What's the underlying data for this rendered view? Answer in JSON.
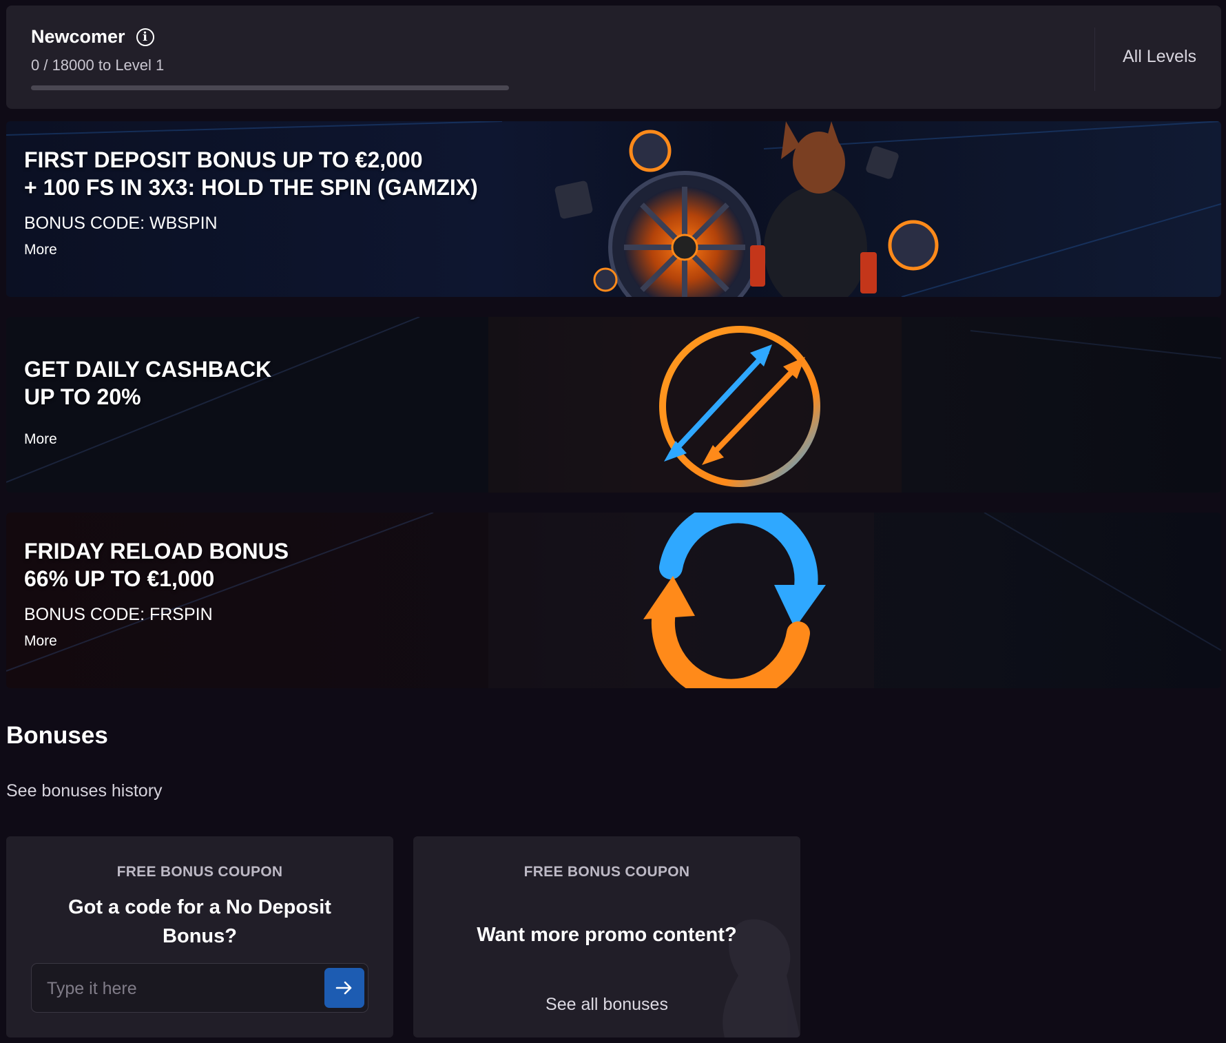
{
  "level": {
    "title": "Newcomer",
    "progress_text": "0 / 18000 to Level 1",
    "progress_fraction": 0.0,
    "all_levels_label": "All Levels"
  },
  "banners": [
    {
      "title_line1": "FIRST DEPOSIT BONUS UP TO €2,000",
      "title_line2": "+ 100 FS IN 3X3: HOLD THE SPIN (GAMZIX)",
      "code": "BONUS CODE: WBSPIN",
      "more": "More"
    },
    {
      "title_line1": "GET DAILY CASHBACK",
      "title_line2": "UP TO 20%",
      "more": "More"
    },
    {
      "title_line1": "FRIDAY RELOAD BONUS",
      "title_line2": "66% UP TO €1,000",
      "code": "BONUS CODE: FRSPIN",
      "more": "More"
    }
  ],
  "bonuses": {
    "title": "Bonuses",
    "history_link": "See bonuses history"
  },
  "coupons": [
    {
      "label": "FREE BONUS COUPON",
      "question_line1": "Got a code for a No Deposit",
      "question_line2": "Bonus?",
      "input_placeholder": "Type it here"
    },
    {
      "label": "FREE BONUS COUPON",
      "question": "Want more promo content?",
      "link": "See all bonuses"
    }
  ],
  "colors": {
    "page_bg": "#0f0b16",
    "card_bg": "#221f29",
    "accent_blue": "#1d5cb2",
    "neon_orange": "#ff8a1a",
    "neon_blue": "#2fa8ff"
  }
}
